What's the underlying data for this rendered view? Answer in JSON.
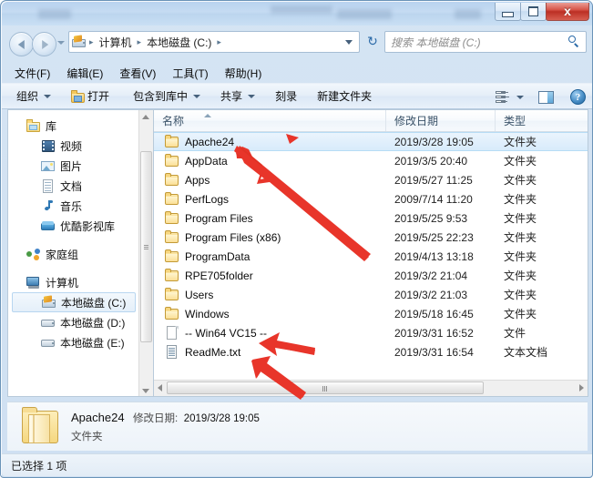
{
  "window": {
    "title": "",
    "controls": {
      "minimize": "",
      "maximize": "",
      "close": "x"
    }
  },
  "address": {
    "root_icon": "drive-c-icon",
    "crumbs": [
      "计算机",
      "本地磁盘 (C:)"
    ],
    "separator": "▸",
    "dropdown_icon": "chevron-down-icon",
    "refresh_icon": "refresh-icon"
  },
  "search": {
    "placeholder": "搜索 本地磁盘 (C:)",
    "value": "",
    "icon": "search-icon"
  },
  "menubar": {
    "items": [
      "文件(F)",
      "编辑(E)",
      "查看(V)",
      "工具(T)",
      "帮助(H)"
    ]
  },
  "toolbar": {
    "organize": "组织",
    "open": "打开",
    "include_in_library": "包含到库中",
    "share": "共享",
    "burn": "刻录",
    "new_folder": "新建文件夹",
    "view_icon": "list-view-icon",
    "panes_icon": "preview-pane-icon",
    "help_icon": "help-icon"
  },
  "navpane": {
    "groups": [
      {
        "label": "库",
        "icon": "library-icon",
        "children": [
          {
            "label": "视频",
            "icon": "video-icon"
          },
          {
            "label": "图片",
            "icon": "picture-icon"
          },
          {
            "label": "文档",
            "icon": "document-icon"
          },
          {
            "label": "音乐",
            "icon": "music-icon"
          },
          {
            "label": "优酷影视库",
            "icon": "youku-library-icon"
          }
        ]
      },
      {
        "label": "家庭组",
        "icon": "homegroup-icon",
        "children": []
      },
      {
        "label": "计算机",
        "icon": "computer-icon",
        "children": [
          {
            "label": "本地磁盘 (C:)",
            "icon": "drive-c-icon",
            "selected": true
          },
          {
            "label": "本地磁盘 (D:)",
            "icon": "drive-icon"
          },
          {
            "label": "本地磁盘 (E:)",
            "icon": "drive-icon"
          }
        ]
      }
    ]
  },
  "filelist": {
    "columns": [
      "名称",
      "修改日期",
      "类型"
    ],
    "sort_column": "名称",
    "sort_direction": "asc",
    "rows": [
      {
        "name": "Apache24",
        "date": "2019/3/28 19:05",
        "type": "文件夹",
        "icon": "folder-icon",
        "selected": true
      },
      {
        "name": "AppData",
        "date": "2019/3/5 20:40",
        "type": "文件夹",
        "icon": "folder-icon",
        "selected": false
      },
      {
        "name": "Apps",
        "date": "2019/5/27 11:25",
        "type": "文件夹",
        "icon": "folder-icon",
        "selected": false
      },
      {
        "name": "PerfLogs",
        "date": "2009/7/14 11:20",
        "type": "文件夹",
        "icon": "folder-icon",
        "selected": false
      },
      {
        "name": "Program Files",
        "date": "2019/5/25 9:53",
        "type": "文件夹",
        "icon": "folder-icon",
        "selected": false
      },
      {
        "name": "Program Files (x86)",
        "date": "2019/5/25 22:23",
        "type": "文件夹",
        "icon": "folder-icon",
        "selected": false
      },
      {
        "name": "ProgramData",
        "date": "2019/4/13 13:18",
        "type": "文件夹",
        "icon": "folder-icon",
        "selected": false
      },
      {
        "name": "RPE705folder",
        "date": "2019/3/2 21:04",
        "type": "文件夹",
        "icon": "folder-icon",
        "selected": false
      },
      {
        "name": "Users",
        "date": "2019/3/2 21:03",
        "type": "文件夹",
        "icon": "folder-icon",
        "selected": false
      },
      {
        "name": "Windows",
        "date": "2019/5/18 16:45",
        "type": "文件夹",
        "icon": "folder-icon",
        "selected": false
      },
      {
        "name": "-- Win64 VC15  --",
        "date": "2019/3/31 16:52",
        "type": "文件",
        "icon": "file-icon",
        "selected": false
      },
      {
        "name": "ReadMe.txt",
        "date": "2019/3/31 16:54",
        "type": "文本文档",
        "icon": "text-file-icon",
        "selected": false
      }
    ]
  },
  "details": {
    "name": "Apache24",
    "date_label": "修改日期:",
    "date_value": "2019/3/28 19:05",
    "type": "文件夹",
    "icon": "open-folder-icon"
  },
  "statusbar": {
    "text": "已选择 1 项"
  },
  "annotations": {
    "color": "#e8352a",
    "arrows": [
      {
        "name": "arrow-to-apache24-row",
        "points_to": "Apache24"
      },
      {
        "name": "arrow-to-win64-vc15-row",
        "points_to": "-- Win64 VC15  --"
      },
      {
        "name": "arrow-to-readme-row",
        "points_to": "ReadMe.txt"
      },
      {
        "name": "arrow-marker-header",
        "points_to": "名称"
      }
    ]
  }
}
